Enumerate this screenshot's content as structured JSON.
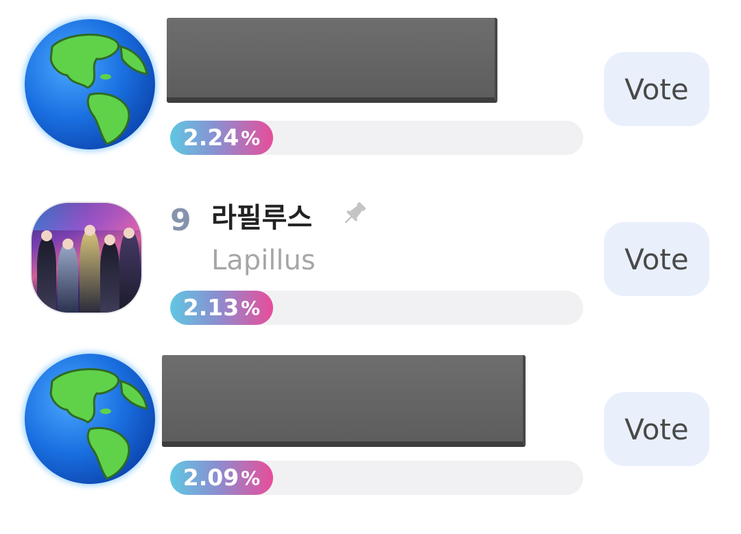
{
  "entries": [
    {
      "avatar_icon": "globe-icon",
      "percent": "2.24",
      "percent_sign": "%",
      "vote_label": "Vote"
    },
    {
      "rank": "9",
      "name": "라필루스",
      "subname": "Lapillus",
      "pin_icon": "pin-icon",
      "percent": "2.13",
      "percent_sign": "%",
      "vote_label": "Vote"
    },
    {
      "avatar_icon": "globe-icon",
      "percent": "2.09",
      "percent_sign": "%",
      "vote_label": "Vote"
    }
  ],
  "colors": {
    "bar_gradient_start": "#5fc7e2",
    "bar_gradient_end": "#e84d9a",
    "rank": "#8593ad",
    "vote_bg": "#e9f0fc"
  }
}
